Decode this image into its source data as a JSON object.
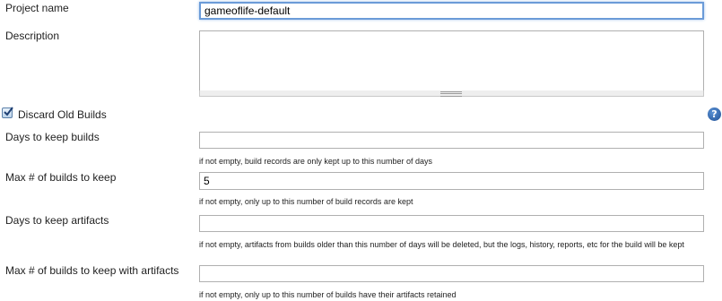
{
  "project": {
    "name_label": "Project name",
    "name_value": "gameoflife-default",
    "description_label": "Description",
    "description_value": ""
  },
  "discard": {
    "checkbox_label": "Discard Old Builds",
    "checked": true,
    "help_icon": "help-icon",
    "help_glyph": "?"
  },
  "fields": [
    {
      "label": "Days to keep builds",
      "value": "",
      "help": "if not empty, build records are only kept up to this number of days"
    },
    {
      "label": "Max # of builds to keep",
      "value": "5",
      "help": "if not empty, only up to this number of build records are kept"
    },
    {
      "label": "Days to keep artifacts",
      "value": "",
      "help": "if not empty, artifacts from builds older than this number of days will be deleted, but the logs, history, reports, etc for the build will be kept"
    },
    {
      "label": "Max # of builds to keep with artifacts",
      "value": "",
      "help": "if not empty, only up to this number of builds have their artifacts retained"
    }
  ],
  "colors": {
    "focus_border": "#6b9bd8",
    "help_icon": "#2b62b0"
  }
}
